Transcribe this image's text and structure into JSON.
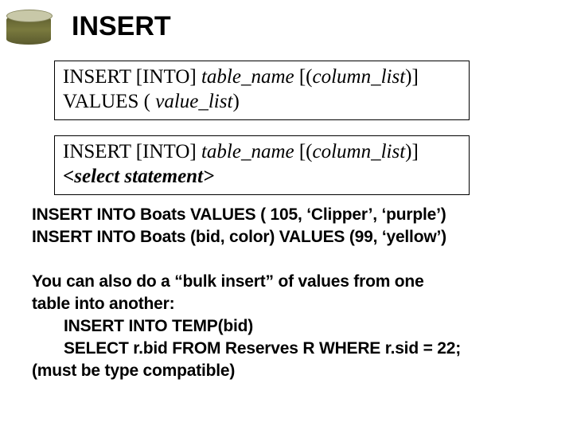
{
  "icon": {
    "label": ""
  },
  "title": "INSERT",
  "syntax1": {
    "part1": "INSERT  [INTO]  ",
    "italic1": "table_name",
    "part2": " [(",
    "italic2": "column_list",
    "part3": ")]",
    "line2a": "VALUES ( ",
    "italic3": "value_list",
    "line2b": ")"
  },
  "syntax2": {
    "part1": "INSERT [INTO] ",
    "italic1": "table_name",
    "part2": " [(",
    "italic2": "column_list",
    "part3": ")]",
    "line2": "<select statement>"
  },
  "examples": {
    "ex1": "INSERT INTO Boats VALUES ( 105, ‘Clipper’, ‘purple’)",
    "ex2": "INSERT INTO Boats  (bid, color) VALUES (99, ‘yellow’)"
  },
  "bulk": {
    "line1": "You can also do a “bulk insert” of values from one",
    "line2": "table into another:",
    "line3": "INSERT INTO TEMP(bid)",
    "line4": "SELECT r.bid FROM Reserves R WHERE  r.sid = 22;",
    "line5": "(must be type compatible)"
  }
}
